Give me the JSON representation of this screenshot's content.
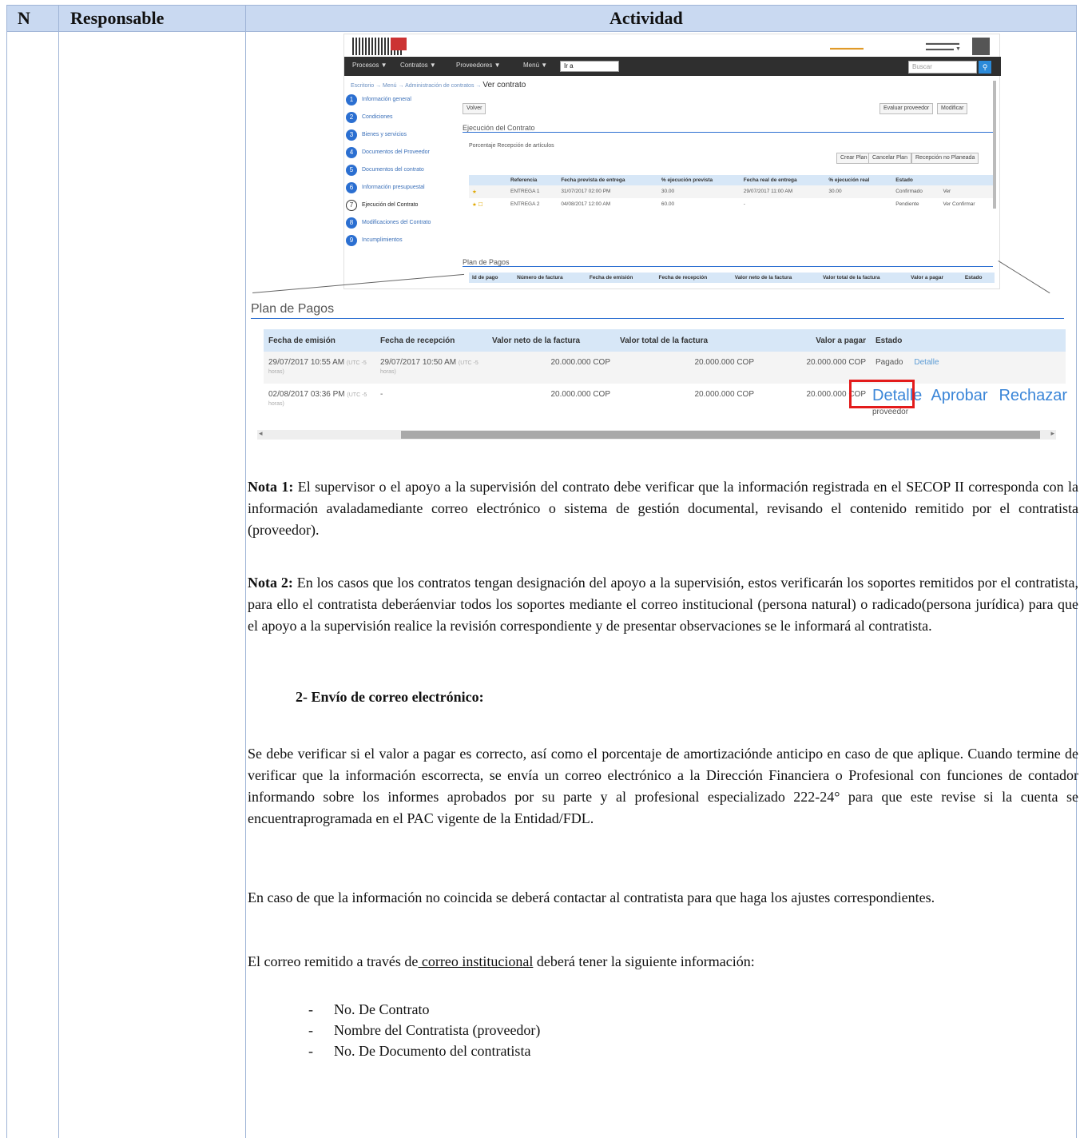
{
  "header": {
    "col_n": "N",
    "col_responsable": "Responsable",
    "col_actividad": "Actividad"
  },
  "mini": {
    "nav": [
      "Procesos ▼",
      "Contratos ▼",
      "Proveedores ▼",
      "Menú ▼"
    ],
    "nav_select": "Ir a",
    "search_placeholder": "Buscar",
    "crumb": "Escritorio → Menú → Administración de contratos →",
    "page_title": "Ver contrato",
    "back_button": "Volver",
    "sidebar": [
      {
        "num": "1",
        "label": "Información general"
      },
      {
        "num": "2",
        "label": "Condiciones"
      },
      {
        "num": "3",
        "label": "Bienes y servicios"
      },
      {
        "num": "4",
        "label": "Documentos del Proveedor"
      },
      {
        "num": "5",
        "label": "Documentos del contrato"
      },
      {
        "num": "6",
        "label": "Información presupuestal"
      },
      {
        "num": "7",
        "label": "Ejecución del Contrato"
      },
      {
        "num": "8",
        "label": "Modificaciones del Contrato"
      },
      {
        "num": "9",
        "label": "Incumplimientos"
      }
    ],
    "section_exec": "Ejecución del Contrato",
    "radio_options": "Porcentaje  Recepción de artículos",
    "btn_crear": "Crear Plan",
    "btn_cancelar": "Cancelar Plan",
    "btn_recepcion": "Recepción no Planeada",
    "btn_evaluar": "Evaluar proveedor",
    "btn_modificar": "Modificar",
    "exec_headers": [
      "Referencia",
      "Fecha prevista de entrega",
      "% ejecución prevista",
      "Fecha real de entrega",
      "% ejecución real",
      "Estado"
    ],
    "exec_rows": [
      [
        "ENTREGA 1",
        "31/07/2017 02:00 PM",
        "30.00",
        "29/07/2017 11:00 AM",
        "30.00",
        "Confirmado",
        "Ver"
      ],
      [
        "ENTREGA 2",
        "04/08/2017 12:00 AM",
        "60.00",
        "-",
        "",
        "Pendiente",
        "Ver  Confirmar"
      ]
    ],
    "section_pagos": "Plan de Pagos",
    "pagos_headers": [
      "Id de pago",
      "Número de factura",
      "Fecha de emisión",
      "Fecha de recepción",
      "Valor neto de la factura",
      "Valor total de la factura",
      "Valor a pagar",
      "Estado"
    ]
  },
  "plan": {
    "title": "Plan de Pagos",
    "headers": [
      "Fecha de emisión",
      "Fecha de recepción",
      "Valor neto de la factura",
      "Valor total de la factura",
      "Valor a pagar",
      "Estado"
    ],
    "rows": [
      {
        "emision": "29/07/2017 10:55 AM",
        "emision_utc": "(UTC -5 horas)",
        "recepcion": "29/07/2017 10:50 AM",
        "recepcion_utc": "(UTC -5 horas)",
        "neto": "20.000.000 COP",
        "total": "20.000.000 COP",
        "pagar": "20.000.000 COP",
        "estado": "Pagado",
        "accion": "Detalle"
      },
      {
        "emision": "02/08/2017 03:36 PM",
        "emision_utc": "(UTC -5 horas)",
        "recepcion": "-",
        "recepcion_utc": "",
        "neto": "20.000.000 COP",
        "total": "20.000.000 COP",
        "pagar": "20.000.000 COP",
        "estado": "proveedor",
        "accion1": "Detalle",
        "accion2": "Aprobar",
        "accion3": "Rechazar"
      }
    ]
  },
  "nota1": {
    "label": "Nota 1:",
    "text": " El supervisor o el apoyo a la supervisión del contrato debe verificar que la información registrada en el SECOP II corresponda con la información avaladamediante correo electrónico o sistema de gestión documental, revisando el contenido remitido por el contratista (proveedor)."
  },
  "nota2": {
    "label": "Nota 2:",
    "text": " En los casos que los contratos tengan designación del apoyo a la supervisión, estos verificarán los soportes remitidos por el contratista, para ello el contratista deberáenviar todos los soportes mediante el correo institucional (persona natural) o radicado(persona jurídica) para que el apoyo a la supervisión realice la revisión correspondiente y de presentar observaciones se le informará al contratista."
  },
  "section2": "2-  Envío de correo electrónico:",
  "para1": "Se debe verificar si el valor a pagar es correcto, así como el porcentaje de amortizaciónde anticipo en caso de que aplique. Cuando termine de verificar que la información escorrecta, se envía un correo electrónico a la Dirección Financiera o Profesional con funciones de contador informando sobre los informes aprobados por su parte y al profesional especializado 222-24° para que este revise si la cuenta se encuentraprogramada en el PAC vigente de la Entidad/FDL.",
  "para2": "En caso de que la información no coincida se deberá contactar al contratista para que haga los ajustes correspondientes.",
  "para3": {
    "before": "El correo remitido a través de",
    "link": " correo institucional",
    "after": " deberá tener la siguiente información:"
  },
  "bullets": [
    "No. De Contrato",
    "Nombre del Contratista (proveedor)",
    "No. De Documento del contratista"
  ]
}
